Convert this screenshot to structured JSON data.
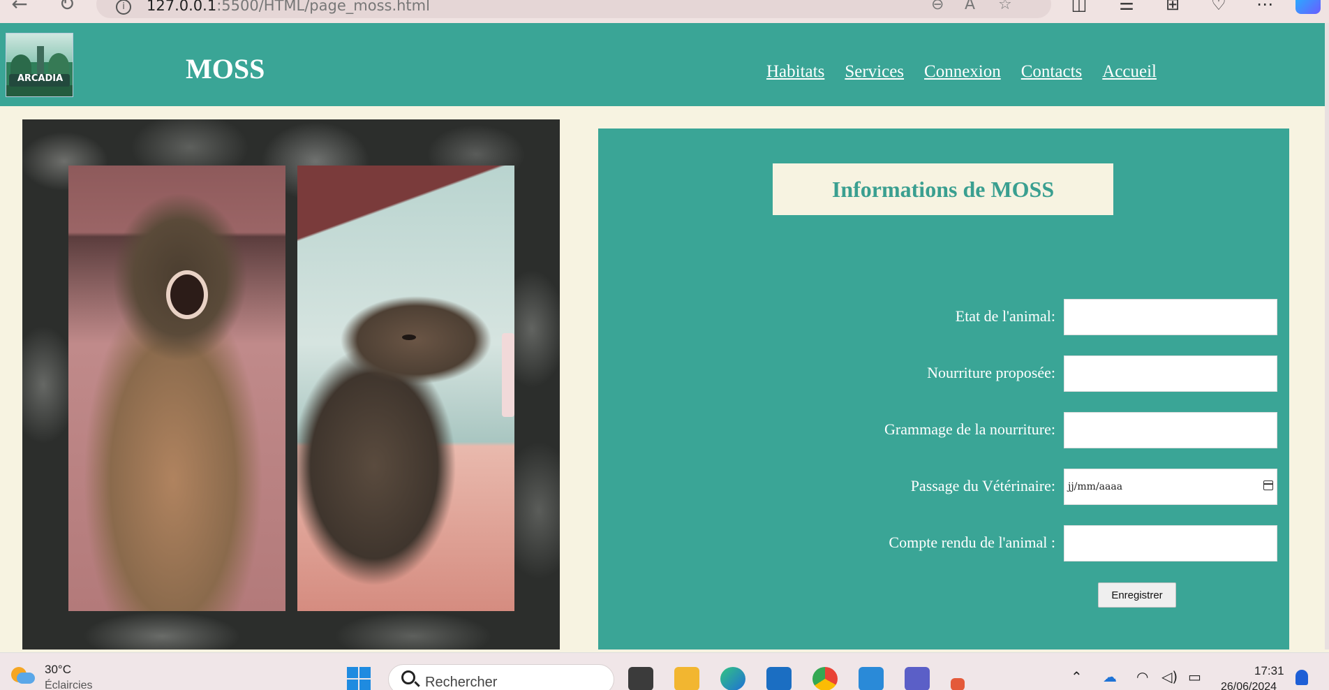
{
  "browser": {
    "url_host": "127.0.0.1",
    "url_rest": ":5500/HTML/page_moss.html",
    "back_glyph": "←",
    "reload_glyph": "↻",
    "icons": [
      "info-icon",
      "zoom-out-icon",
      "read-aloud-icon",
      "favorite-star-icon",
      "split-screen-icon",
      "favorites-icon",
      "collections-icon",
      "browser-essentials-icon",
      "more-icon",
      "copilot-icon"
    ]
  },
  "header": {
    "logo_text": "ARCADIA",
    "title": "MOSS",
    "nav": [
      "Habitats",
      "Services",
      "Connexion",
      "Contacts",
      "Accueil"
    ]
  },
  "form": {
    "title": "Informations de MOSS",
    "fields": [
      {
        "label": "Etat de l'animal:",
        "value": ""
      },
      {
        "label": "Nourriture proposée:",
        "value": ""
      },
      {
        "label": "Grammage de la nourriture:",
        "value": ""
      },
      {
        "label": "Passage du Vétérinaire:",
        "value": "jj/mm/aaaa"
      },
      {
        "label": "Compte rendu de l'animal :",
        "value": ""
      }
    ],
    "submit_label": "Enregistrer"
  },
  "taskbar": {
    "weather_temp": "30°C",
    "weather_desc": "Éclaircies",
    "search_placeholder": "Rechercher",
    "time": "17:31",
    "date": "26/06/2024",
    "apps": [
      "task-view-icon",
      "file-explorer-icon",
      "edge-icon",
      "store-icon",
      "chrome-icon",
      "vscode-icon",
      "teams-icon",
      "app-icon"
    ],
    "tray": [
      "chevron-up-icon",
      "onedrive-icon",
      "wifi-icon",
      "volume-icon",
      "battery-icon",
      "notification-bell-icon"
    ]
  },
  "colors": {
    "teal": "#3aa596",
    "cream": "#f7f3e1"
  }
}
